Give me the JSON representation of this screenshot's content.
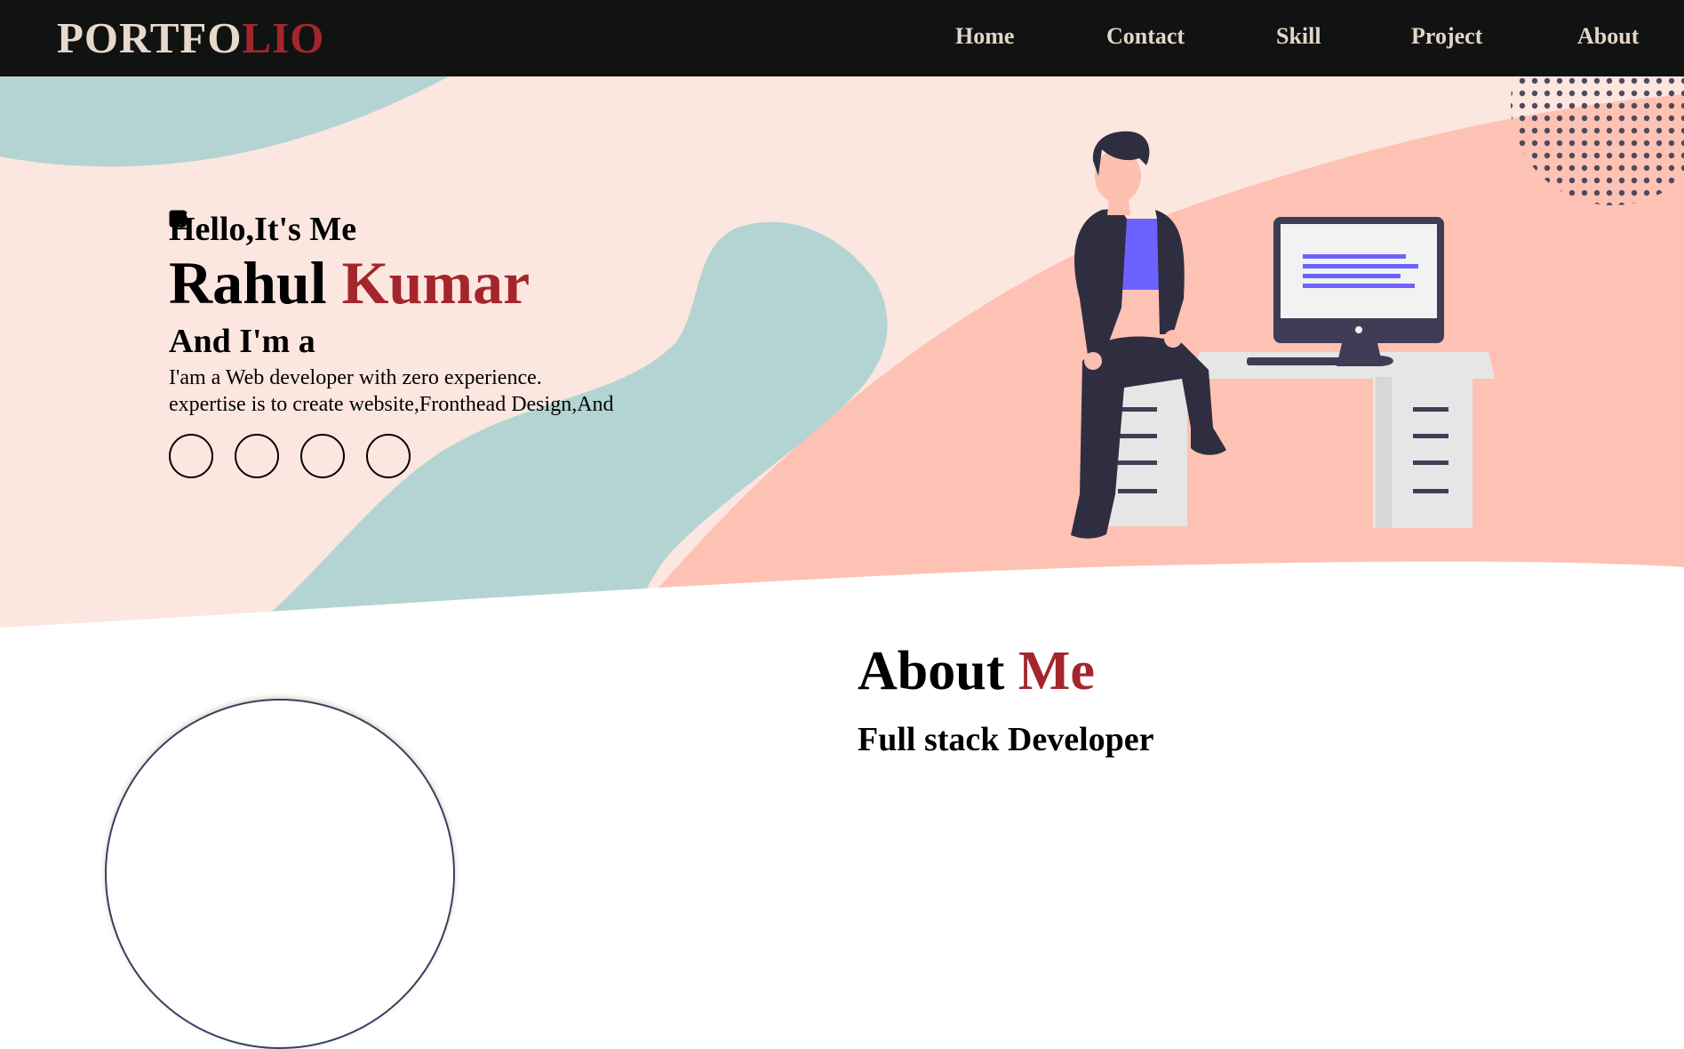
{
  "logo": {
    "part1": "PORTFO",
    "part2": "LIO"
  },
  "nav": [
    "Home",
    "Contact",
    "Skill",
    "Project",
    "About"
  ],
  "hero": {
    "greeting": "Hello,It's Me",
    "first_name": "Rahul",
    "last_name": "Kumar",
    "role_prefix": "And I'm a",
    "description_line1": "I'am a Web developer with zero experience.",
    "description_line2": "expertise is to create website,Fronthead Design,And",
    "socials": [
      "instagram-icon",
      "twitter-icon",
      "linkedin-icon",
      "github-icon"
    ]
  },
  "about": {
    "title_part1": "About",
    "title_part2": "Me",
    "subtitle": "Full stack Developer"
  },
  "colors": {
    "navbar": "#111212",
    "accent": "#a4262c",
    "nav_text": "#e3d6c6",
    "hero_bg": "#fce6e0",
    "teal": "#b3d4d2",
    "salmon": "#fdc2b4",
    "monitor_text": "#6c63ff"
  }
}
